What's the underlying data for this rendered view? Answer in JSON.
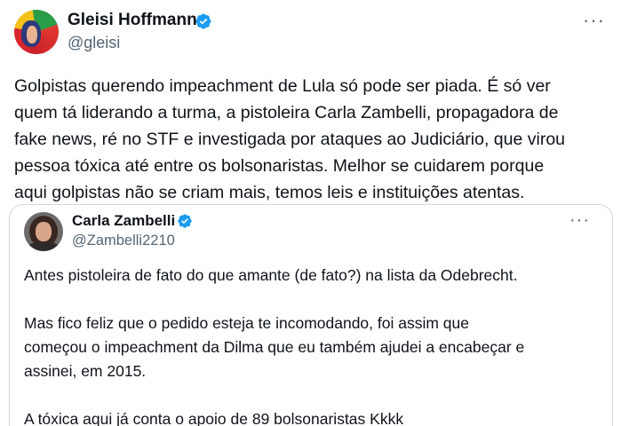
{
  "post": {
    "author_name": "Gleisi Hoffmann",
    "author_handle": "@gleisi",
    "more_label": "···",
    "text": "Golpistas querendo impeachment de Lula só pode ser piada. É só ver\nquem tá liderando a turma, a pistoleira Carla Zambelli, propagadora de\nfake news, ré no STF e investigada por ataques ao Judiciário, que virou\npessoa tóxica até entre os bolsonaristas. Melhor se cuidarem porque\naqui golpistas não se criam mais, temos leis e instituições atentas."
  },
  "quote": {
    "author_name": "Carla Zambelli",
    "author_handle": "@Zambelli2210",
    "more_label": "···",
    "paragraph_1": "Antes pistoleira de fato do que amante (de fato?) na lista da Odebrecht.",
    "paragraph_2": "Mas fico feliz que o pedido esteja te incomodando, foi assim que\ncomeçou o impeachment da Dilma que eu também ajudei a encabeçar e\nassinei, em 2015.",
    "paragraph_3": "A tóxica aqui já conta o apoio de 89 bolsonaristas Kkkk"
  },
  "icons": {
    "verified": "verified-badge-icon",
    "more": "more-options-icon"
  },
  "colors": {
    "verified": "#1d9bf0",
    "text": "#0f1419",
    "secondary": "#536471",
    "border": "#cfd9de"
  }
}
